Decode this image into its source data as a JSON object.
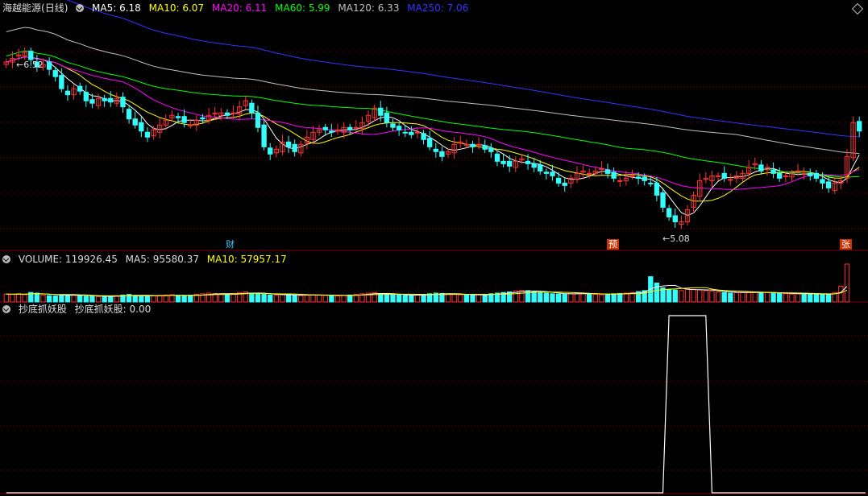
{
  "header": {
    "stock_name": "海越能源",
    "period": "(日线)",
    "ma": [
      {
        "label": "MA5: 6.18",
        "color": "#ffffff"
      },
      {
        "label": "MA10: 6.07",
        "color": "#ffff00"
      },
      {
        "label": "MA20: 6.11",
        "color": "#ff00ff"
      },
      {
        "label": "MA60: 5.99",
        "color": "#00ff00"
      },
      {
        "label": "MA120: 6.33",
        "color": "#c0c0c0"
      },
      {
        "label": "MA250: 7.06",
        "color": "#3333ff"
      }
    ]
  },
  "volume_header": {
    "label": "VOLUME: 119926.45",
    "ma5": "MA5: 95580.37",
    "ma10": "MA10: 57957.17"
  },
  "indicator_header": {
    "name": "抄底抓妖股",
    "value_label": "抄底抓妖股: 0.00"
  },
  "markers": {
    "cai": "财",
    "yu": "预",
    "zhang": "张",
    "high": "6.52",
    "low": "5.08"
  },
  "colors": {
    "up": "#ff3333",
    "down": "#33ffff",
    "grid": "#800000",
    "signal": "#ffffff"
  },
  "chart_data": {
    "type": "candlestick",
    "price": {
      "ylim": [
        4.95,
        6.8
      ],
      "closes": [
        6.42,
        6.45,
        6.48,
        6.5,
        6.44,
        6.38,
        6.4,
        6.36,
        6.3,
        6.2,
        6.15,
        6.2,
        6.18,
        6.1,
        6.08,
        6.12,
        6.1,
        6.09,
        6.12,
        6.05,
        5.95,
        5.9,
        5.85,
        5.8,
        5.86,
        5.9,
        5.94,
        5.98,
        5.96,
        5.92,
        5.9,
        5.94,
        5.95,
        5.98,
        6.0,
        6.0,
        5.98,
        6.0,
        6.05,
        6.1,
        6.0,
        5.88,
        5.72,
        5.66,
        5.7,
        5.76,
        5.72,
        5.68,
        5.74,
        5.8,
        5.84,
        5.86,
        5.86,
        5.84,
        5.86,
        5.88,
        5.86,
        5.88,
        5.92,
        5.98,
        6.04,
        5.98,
        5.92,
        5.88,
        5.86,
        5.84,
        5.82,
        5.84,
        5.78,
        5.72,
        5.68,
        5.64,
        5.68,
        5.74,
        5.76,
        5.74,
        5.72,
        5.74,
        5.7,
        5.68,
        5.6,
        5.58,
        5.56,
        5.6,
        5.62,
        5.58,
        5.55,
        5.52,
        5.5,
        5.48,
        5.42,
        5.4,
        5.46,
        5.5,
        5.52,
        5.5,
        5.52,
        5.54,
        5.5,
        5.46,
        5.44,
        5.46,
        5.48,
        5.46,
        5.44,
        5.42,
        5.32,
        5.22,
        5.14,
        5.1,
        5.1,
        5.2,
        5.32,
        5.44,
        5.46,
        5.48,
        5.48,
        5.46,
        5.45,
        5.48,
        5.5,
        5.55,
        5.58,
        5.52,
        5.55,
        5.5,
        5.46,
        5.48,
        5.5,
        5.52,
        5.5,
        5.48,
        5.46,
        5.42,
        5.38,
        5.42,
        5.44,
        5.64,
        5.92,
        5.85
      ],
      "high_annotation": 6.52,
      "low_annotation": 5.08,
      "ma_series": [
        {
          "name": "MA5",
          "color": "#ffffff"
        },
        {
          "name": "MA10",
          "color": "#ffff00"
        },
        {
          "name": "MA20",
          "color": "#ff00ff"
        },
        {
          "name": "MA60",
          "color": "#00ff00"
        },
        {
          "name": "MA120",
          "color": "#c0c0c0"
        },
        {
          "name": "MA250",
          "color": "#3333ff"
        }
      ]
    },
    "volume": {
      "values": [
        25000,
        24000,
        26000,
        23000,
        30000,
        28000,
        22000,
        20000,
        19000,
        21000,
        23000,
        22000,
        20000,
        18000,
        19000,
        17000,
        18000,
        16000,
        20000,
        22000,
        24000,
        21000,
        19000,
        18000,
        20000,
        21000,
        22000,
        23000,
        20000,
        19000,
        21000,
        24000,
        26000,
        28000,
        27000,
        25000,
        24000,
        26000,
        30000,
        32000,
        28000,
        26000,
        24000,
        22000,
        21000,
        23000,
        24000,
        22000,
        20000,
        21000,
        23000,
        22000,
        21000,
        20000,
        19000,
        21000,
        22000,
        24000,
        26000,
        28000,
        30000,
        26000,
        24000,
        22000,
        23000,
        21000,
        20000,
        22000,
        24000,
        26000,
        28000,
        27000,
        25000,
        24000,
        23000,
        22000,
        21000,
        23000,
        24000,
        26000,
        28000,
        30000,
        32000,
        35000,
        37000,
        36000,
        33000,
        30000,
        28000,
        26000,
        25000,
        24000,
        26000,
        28000,
        27000,
        25000,
        24000,
        23000,
        25000,
        26000,
        27000,
        28000,
        30000,
        33000,
        36000,
        80000,
        60000,
        45000,
        40000,
        38000,
        36000,
        42000,
        40000,
        38000,
        36000,
        34000,
        32000,
        30000,
        28000,
        29000,
        30000,
        32000,
        31000,
        30000,
        29000,
        28000,
        27000,
        26000,
        25000,
        26000,
        27000,
        26000,
        25000,
        24000,
        23000,
        30000,
        50000,
        119926
      ]
    },
    "indicator": {
      "values": [
        0,
        0,
        0,
        0,
        0,
        0,
        0,
        0,
        0,
        0,
        0,
        0,
        0,
        0,
        0,
        0,
        0,
        0,
        0,
        0,
        0,
        0,
        0,
        0,
        0,
        0,
        0,
        0,
        0,
        0,
        0,
        0,
        0,
        0,
        0,
        0,
        0,
        0,
        0,
        0,
        0,
        0,
        0,
        0,
        0,
        0,
        0,
        0,
        0,
        0,
        0,
        0,
        0,
        0,
        0,
        0,
        0,
        0,
        0,
        0,
        0,
        0,
        0,
        0,
        0,
        0,
        0,
        0,
        0,
        0,
        0,
        0,
        0,
        0,
        0,
        0,
        0,
        0,
        0,
        0,
        0,
        0,
        0,
        0,
        0,
        0,
        0,
        0,
        0,
        0,
        0,
        0,
        0,
        0,
        0,
        0,
        0,
        0,
        0,
        0,
        0,
        0,
        0,
        0,
        0,
        0,
        0,
        0,
        1,
        1,
        1,
        1,
        1,
        1,
        1,
        0,
        0,
        0,
        0,
        0,
        0,
        0,
        0,
        0,
        0,
        0,
        0,
        0,
        0,
        0,
        0,
        0,
        0,
        0,
        0,
        0,
        0,
        0,
        0,
        0,
        0
      ],
      "ylim": [
        0,
        1
      ]
    }
  }
}
